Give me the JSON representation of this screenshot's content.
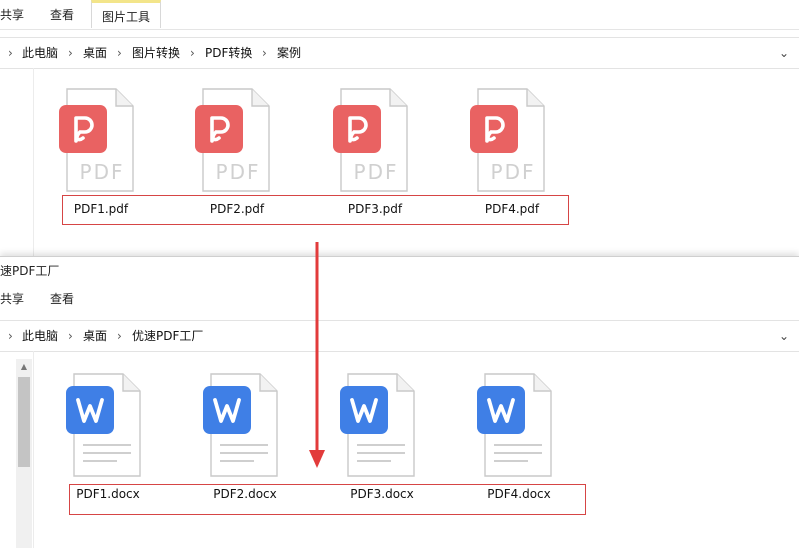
{
  "top_window": {
    "ribbon_tabs": [
      {
        "label": "共享"
      },
      {
        "label": "查看"
      },
      {
        "label": "图片工具",
        "active": true
      }
    ],
    "breadcrumb": [
      "此电脑",
      "桌面",
      "图片转换",
      "PDF转换",
      "案例"
    ],
    "files": [
      {
        "name": "PDF1.pdf",
        "type_text": "PDF",
        "icon": "pdf-file-icon"
      },
      {
        "name": "PDF2.pdf",
        "type_text": "PDF",
        "icon": "pdf-file-icon"
      },
      {
        "name": "PDF3.pdf",
        "type_text": "PDF",
        "icon": "pdf-file-icon"
      },
      {
        "name": "PDF4.pdf",
        "type_text": "PDF",
        "icon": "pdf-file-icon"
      }
    ]
  },
  "bottom_window": {
    "title": "速PDF工厂",
    "ribbon_tabs": [
      {
        "label": "共享"
      },
      {
        "label": "查看"
      }
    ],
    "breadcrumb": [
      "此电脑",
      "桌面",
      "优速PDF工厂"
    ],
    "files": [
      {
        "name": "PDF1.docx",
        "icon": "word-file-icon"
      },
      {
        "name": "PDF2.docx",
        "icon": "word-file-icon"
      },
      {
        "name": "PDF3.docx",
        "icon": "word-file-icon"
      },
      {
        "name": "PDF4.docx",
        "icon": "word-file-icon"
      }
    ]
  },
  "colors": {
    "pdf_badge": "#e96262",
    "word_badge": "#3f7fe6",
    "highlight_box": "#d64545",
    "arrow": "#e23b3b",
    "active_tab_accent": "#f3e58a"
  }
}
